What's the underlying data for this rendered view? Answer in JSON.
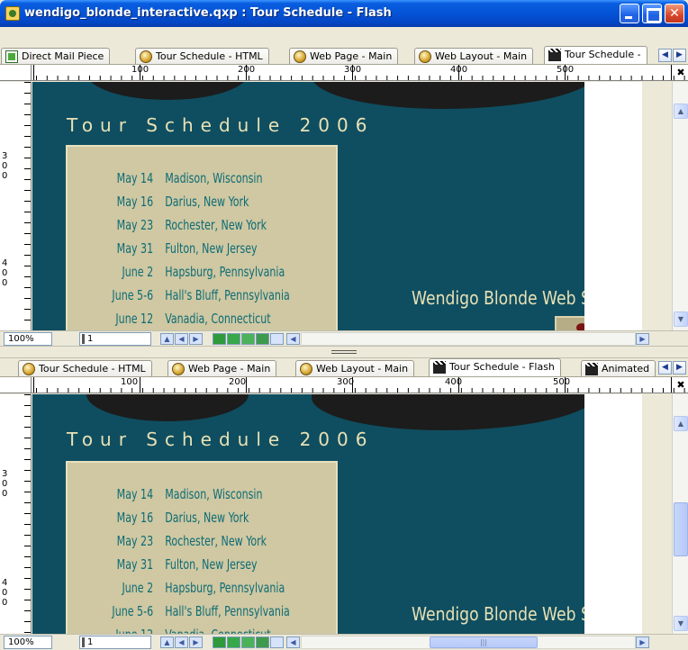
{
  "window": {
    "title": "wendigo_blonde_interactive.qxp : Tour Schedule - Flash"
  },
  "top_pane": {
    "tabs": [
      {
        "label": "Direct Mail Piece",
        "icon": "print-layout-icon"
      },
      {
        "label": "Tour Schedule - HTML",
        "icon": "web-layout-icon"
      },
      {
        "label": "Web Page - Main",
        "icon": "web-layout-icon"
      },
      {
        "label": "Web Layout - Main",
        "icon": "web-layout-icon"
      },
      {
        "label": "Tour Schedule -",
        "icon": "interactive-layout-icon",
        "active": true
      }
    ],
    "ruler_labels": [
      "100",
      "200",
      "300",
      "400",
      "500"
    ],
    "vruler_digits": [
      "3",
      "0",
      "0",
      "4",
      "0",
      "0"
    ],
    "zoom": "100%",
    "page": "1"
  },
  "bottom_pane": {
    "tabs": [
      {
        "label": "Tour Schedule - HTML",
        "icon": "web-layout-icon"
      },
      {
        "label": "Web Page - Main",
        "icon": "web-layout-icon"
      },
      {
        "label": "Web Layout - Main",
        "icon": "web-layout-icon"
      },
      {
        "label": "Tour Schedule - Flash",
        "icon": "interactive-layout-icon",
        "active": true
      },
      {
        "label": "Animated",
        "icon": "interactive-layout-icon"
      }
    ],
    "ruler_labels": [
      "100",
      "200",
      "300",
      "400",
      "500"
    ],
    "vruler_digits": [
      "3",
      "0",
      "0",
      "4",
      "0",
      "0"
    ],
    "zoom": "100%",
    "page": "1"
  },
  "layout": {
    "title": "Tour Schedule 2006",
    "schedule": [
      {
        "date": "May 14",
        "place": "Madison, Wisconsin"
      },
      {
        "date": "May 16",
        "place": "Darius, New York"
      },
      {
        "date": "May 23",
        "place": "Rochester, New York"
      },
      {
        "date": "May 31",
        "place": "Fulton, New Jersey"
      },
      {
        "date": "June 2",
        "place": "Hapsburg, Pennsylvania"
      },
      {
        "date": "June 5-6",
        "place": "Hall's Bluff, Pennsylvania"
      },
      {
        "date": "June 12",
        "place": "Vanadia, Connecticut"
      }
    ],
    "site_link": "Wendigo Blonde Web Site"
  },
  "colors": {
    "stage": "#0f4e60",
    "schedule_box": "#cfc8a2",
    "schedule_text": "#0d6b76",
    "title_text": "#e8e1b5"
  }
}
